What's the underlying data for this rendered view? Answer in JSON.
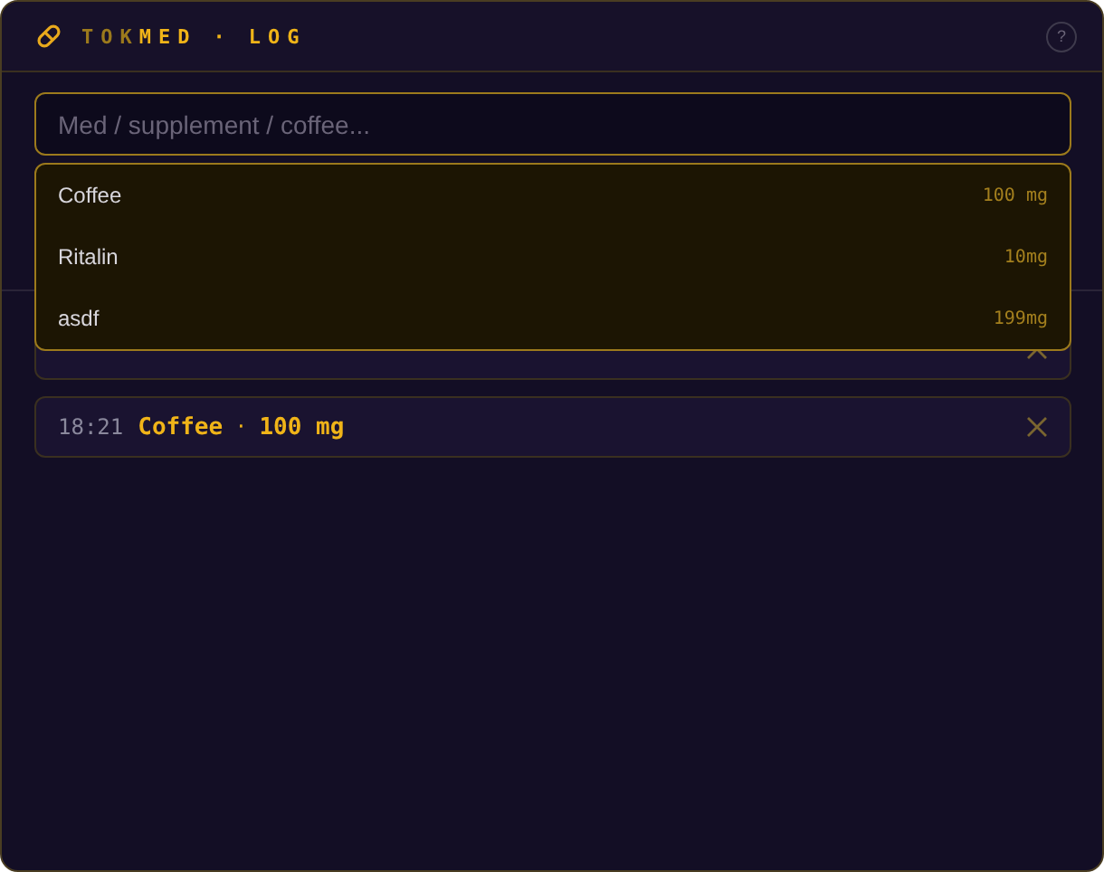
{
  "header": {
    "title_parts": [
      {
        "text": "TOK",
        "accent": false
      },
      {
        "text": "MED",
        "accent": true
      },
      {
        "text": "·",
        "accent": true
      },
      {
        "text": "LOG",
        "accent": true
      }
    ],
    "help": "?"
  },
  "search": {
    "placeholder": "Med / supplement / coffee..."
  },
  "suggestions": [
    {
      "name": "Coffee",
      "dose": "100 mg"
    },
    {
      "name": "Ritalin",
      "dose": "10mg"
    },
    {
      "name": "asdf",
      "dose": "199mg"
    }
  ],
  "entries": [
    {
      "kind": "covered"
    },
    {
      "kind": "full",
      "time": "18:21",
      "name": "Coffee",
      "separator": "·",
      "dose": "100 mg"
    }
  ]
}
